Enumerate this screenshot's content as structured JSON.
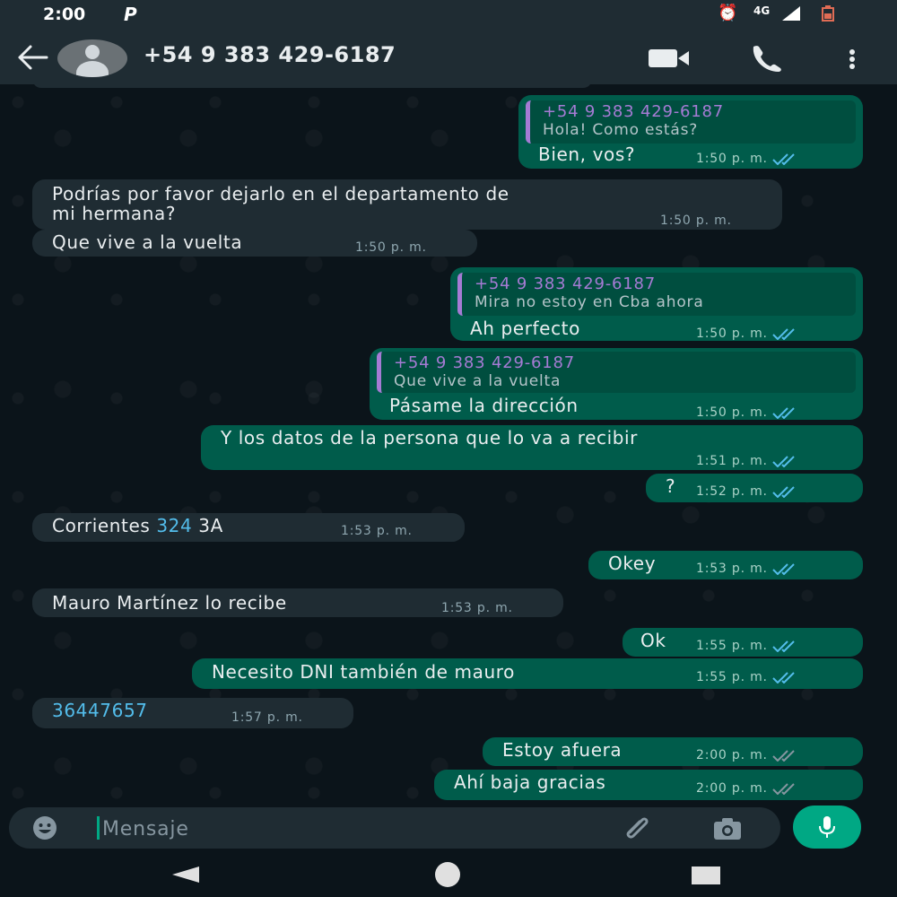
{
  "status_bar": {
    "time": "2:00",
    "network": "4G",
    "icons": [
      "p-icon",
      "alarm-icon",
      "signal-icon",
      "battery-icon"
    ]
  },
  "header": {
    "contact_name": "+54 9 383 429-6187",
    "icons": [
      "back-arrow-icon",
      "avatar-icon",
      "video-call-icon",
      "phone-call-icon",
      "more-vert-icon"
    ]
  },
  "messages": [
    {
      "dir": "out",
      "quote": {
        "name": "+54 9 383 429-6187",
        "text": "Hola! Como estás?"
      },
      "text": "Bien, vos?",
      "time": "1:50 p. m."
    },
    {
      "dir": "in",
      "text_line1": "Podrías por favor dejarlo en el departamento de",
      "text_line2": "mi hermana?",
      "time": "1:50 p. m."
    },
    {
      "dir": "in",
      "text": "Que vive a la vuelta",
      "time": "1:50 p. m."
    },
    {
      "dir": "out",
      "quote": {
        "name": "+54 9 383 429-6187",
        "text": "Mira no estoy en Cba ahora"
      },
      "text": "Ah perfecto",
      "time": "1:50 p. m."
    },
    {
      "dir": "out",
      "quote": {
        "name": "+54 9 383 429-6187",
        "text": "Que vive a la vuelta"
      },
      "text": "Pásame la dirección",
      "time": "1:50 p. m."
    },
    {
      "dir": "out",
      "text": "Y los datos de la persona que lo va a recibir",
      "time": "1:51 p. m."
    },
    {
      "dir": "out",
      "text": "?",
      "time": "1:52 p. m."
    },
    {
      "dir": "in",
      "text_pre": "Corrientes ",
      "text_link": "324",
      "text_post": " 3A",
      "time": "1:53 p. m."
    },
    {
      "dir": "out",
      "text": "Okey",
      "time": "1:53 p. m."
    },
    {
      "dir": "in",
      "text": "Mauro Martínez lo recibe",
      "time": "1:53 p. m."
    },
    {
      "dir": "out",
      "text": "Ok",
      "time": "1:55 p. m."
    },
    {
      "dir": "out",
      "text": "Necesito DNI también  de mauro",
      "time": "1:55 p. m."
    },
    {
      "dir": "in",
      "text_link": "36447657",
      "time": "1:57 p. m."
    },
    {
      "dir": "out",
      "text": "Estoy afuera",
      "time": "2:00 p. m."
    },
    {
      "dir": "out",
      "text": "Ahí baja gracias",
      "time": "2:00 p. m."
    }
  ],
  "composer": {
    "placeholder": "Mensaje",
    "icons": [
      "emoji-icon",
      "attach-clip-icon",
      "camera-icon",
      "mic-icon"
    ]
  },
  "navbar": {
    "icons": [
      "nav-back-icon",
      "nav-home-icon",
      "nav-recents-icon"
    ]
  },
  "colors": {
    "background": "#0b141a",
    "incoming_bubble": "#1f2c33",
    "outgoing_bubble": "#005c4b",
    "quote_accent": "#a57bd4",
    "link": "#53bdeb",
    "accent": "#00a884",
    "read_ticks": "#53bdeb"
  }
}
